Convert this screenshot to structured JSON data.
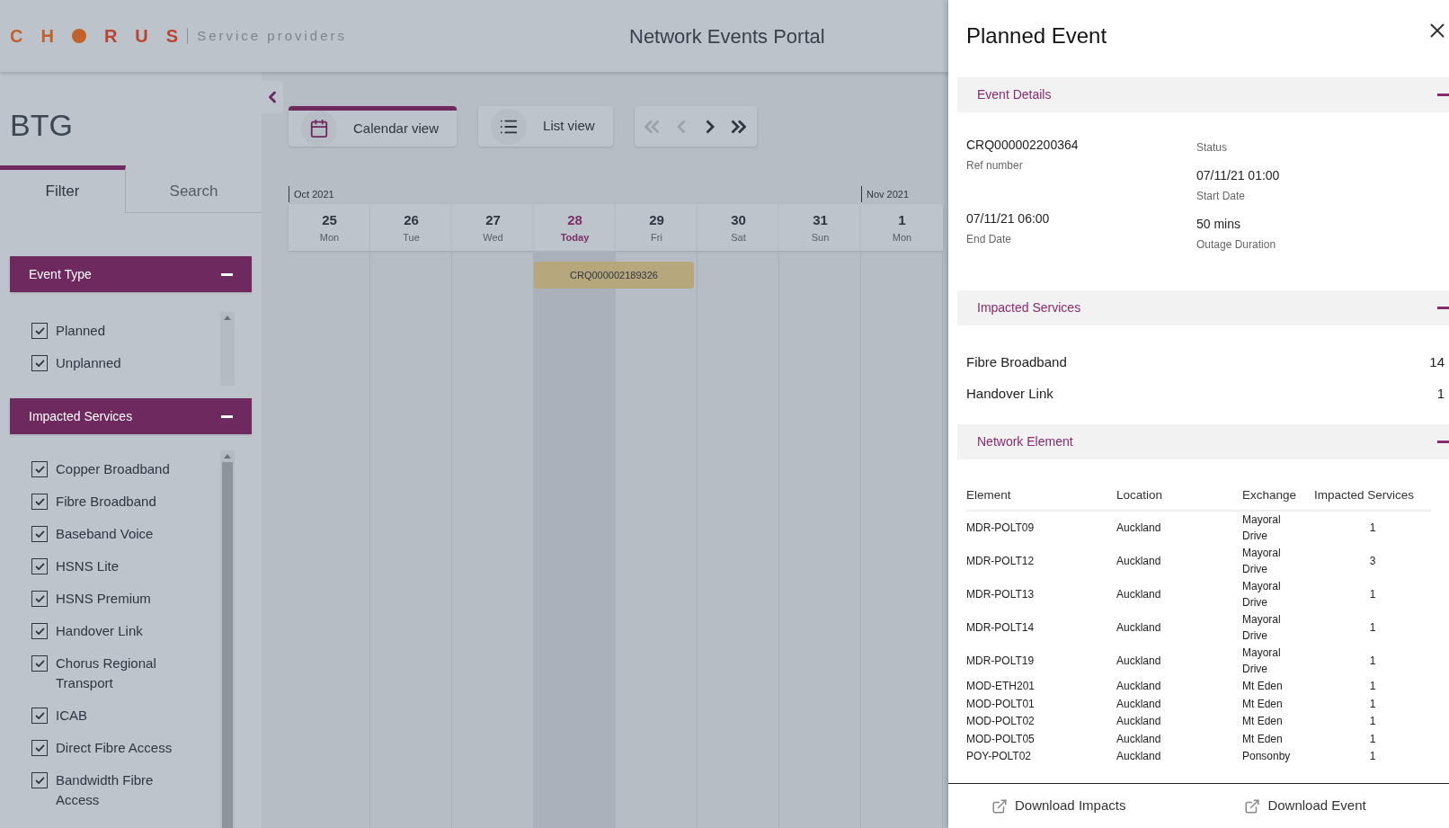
{
  "header": {
    "logo": {
      "before_dot": [
        "C",
        "H"
      ],
      "after_dot": [
        "R",
        "U",
        "S"
      ]
    },
    "tagline": "Service providers",
    "title": "Network Events Portal"
  },
  "sidebar": {
    "title": "BTG",
    "tabs": [
      {
        "label": "Filter",
        "selected": true
      },
      {
        "label": "Search",
        "selected": false
      }
    ],
    "sections": [
      {
        "title": "Event Type",
        "expanded": true,
        "items": [
          {
            "label": "Planned",
            "checked": true
          },
          {
            "label": "Unplanned",
            "checked": true
          }
        ]
      },
      {
        "title": "Impacted Services",
        "expanded": true,
        "items": [
          {
            "label": "Copper Broadband",
            "checked": true
          },
          {
            "label": "Fibre Broadband",
            "checked": true
          },
          {
            "label": "Baseband Voice",
            "checked": true
          },
          {
            "label": "HSNS Lite",
            "checked": true
          },
          {
            "label": "HSNS Premium",
            "checked": true
          },
          {
            "label": "Handover Link",
            "checked": true
          },
          {
            "label": "Chorus Regional Transport",
            "checked": true
          },
          {
            "label": "ICAB",
            "checked": true
          },
          {
            "label": "Direct Fibre Access",
            "checked": true
          },
          {
            "label": "Bandwidth Fibre Access",
            "checked": true
          }
        ]
      }
    ]
  },
  "views": [
    {
      "kind": "calendar",
      "label": "Calendar view",
      "selected": true
    },
    {
      "kind": "list",
      "label": "List view",
      "selected": false
    }
  ],
  "pager": [
    {
      "kind": "first",
      "disabled": true
    },
    {
      "kind": "prev",
      "disabled": true
    },
    {
      "kind": "next",
      "disabled": false
    },
    {
      "kind": "last",
      "disabled": false
    }
  ],
  "days": [
    {
      "date": "25",
      "weekday": "Mon",
      "today": false,
      "month": "Oct 2021"
    },
    {
      "date": "26",
      "weekday": "Tue",
      "today": false
    },
    {
      "date": "27",
      "weekday": "Wed",
      "today": false
    },
    {
      "date": "28",
      "weekday": "Today",
      "today": true,
      "event": "CRQ000002189326"
    },
    {
      "date": "29",
      "weekday": "Fri",
      "today": false
    },
    {
      "date": "30",
      "weekday": "Sat",
      "today": false
    },
    {
      "date": "31",
      "weekday": "Sun",
      "today": false
    },
    {
      "date": "1",
      "weekday": "Mon",
      "today": false,
      "month": "Nov 2021"
    }
  ],
  "drawer": {
    "title": "Planned Event",
    "event_details": {
      "title": "Event Details",
      "expanded": true,
      "left": [
        {
          "value": "CRQ000002200364",
          "label": "Ref number"
        },
        {
          "value": "07/11/21 06:00",
          "label": "End Date"
        }
      ],
      "right": [
        {
          "label": "Status"
        },
        {
          "value": "07/11/21 01:00",
          "label": "Start Date"
        },
        {
          "value": "50 mins",
          "label": "Outage Duration"
        }
      ]
    },
    "impacted_services": {
      "title": "Impacted Services",
      "expanded": true,
      "items": [
        {
          "name": "Fibre Broadband",
          "count": "14"
        },
        {
          "name": "Handover Link",
          "count": "1"
        }
      ]
    },
    "network_element": {
      "title": "Network Element",
      "expanded": true,
      "columns": [
        "Element",
        "Location",
        "Exchange",
        "Impacted Services"
      ],
      "rows": [
        [
          "MDR-POLT09",
          "Auckland",
          "Mayoral Drive",
          "1"
        ],
        [
          "MDR-POLT12",
          "Auckland",
          "Mayoral Drive",
          "3"
        ],
        [
          "MDR-POLT13",
          "Auckland",
          "Mayoral Drive",
          "1"
        ],
        [
          "MDR-POLT14",
          "Auckland",
          "Mayoral Drive",
          "1"
        ],
        [
          "MDR-POLT19",
          "Auckland",
          "Mayoral Drive",
          "1"
        ],
        [
          "MOD-ETH201",
          "Auckland",
          "Mt Eden",
          "1"
        ],
        [
          "MOD-POLT01",
          "Auckland",
          "Mt Eden",
          "1"
        ],
        [
          "MOD-POLT02",
          "Auckland",
          "Mt Eden",
          "1"
        ],
        [
          "MOD-POLT05",
          "Auckland",
          "Mt Eden",
          "1"
        ],
        [
          "POY-POLT02",
          "Auckland",
          "Ponsonby",
          "1"
        ]
      ]
    },
    "actions": [
      "Download Impacts",
      "Download Event"
    ]
  }
}
